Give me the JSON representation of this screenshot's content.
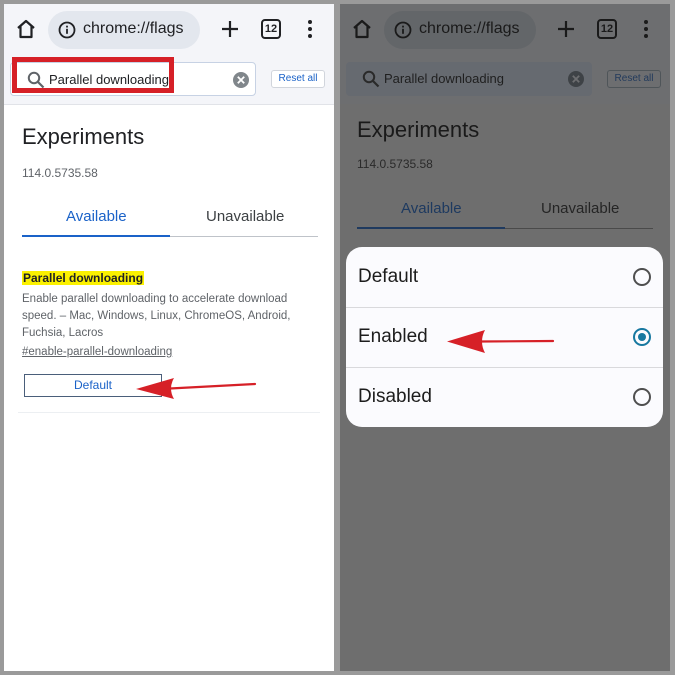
{
  "colors": {
    "accent": "#1a62c8",
    "highlight": "#fbf100",
    "annotation_red": "#d62027",
    "radio_selected": "#1778a0"
  },
  "left": {
    "toolbar": {
      "url": "chrome://flags",
      "tab_count": "12",
      "icons": [
        "home-icon",
        "info-icon",
        "plus-icon",
        "tabs-icon",
        "more-vert-icon"
      ]
    },
    "search": {
      "value": "Parallel downloading",
      "reset_label": "Reset all"
    },
    "page": {
      "title": "Experiments",
      "version": "114.0.5735.58",
      "tabs": [
        {
          "label": "Available",
          "active": true
        },
        {
          "label": "Unavailable",
          "active": false
        }
      ]
    },
    "experiment": {
      "name": "Parallel downloading",
      "description": "Enable parallel downloading to accelerate download speed. – Mac, Windows, Linux, ChromeOS, Android, Fuchsia, Lacros",
      "link": "#enable-parallel-downloading",
      "selected_value": "Default"
    }
  },
  "right": {
    "toolbar": {
      "url": "chrome://flags",
      "tab_count": "12"
    },
    "search": {
      "value": "Parallel downloading",
      "reset_label": "Reset all"
    },
    "page": {
      "title": "Experiments",
      "version": "114.0.5735.58",
      "tabs": [
        {
          "label": "Available",
          "active": true
        },
        {
          "label": "Unavailable",
          "active": false
        }
      ]
    },
    "dialog": {
      "options": [
        {
          "label": "Default",
          "selected": false
        },
        {
          "label": "Enabled",
          "selected": true
        },
        {
          "label": "Disabled",
          "selected": false
        }
      ]
    }
  }
}
